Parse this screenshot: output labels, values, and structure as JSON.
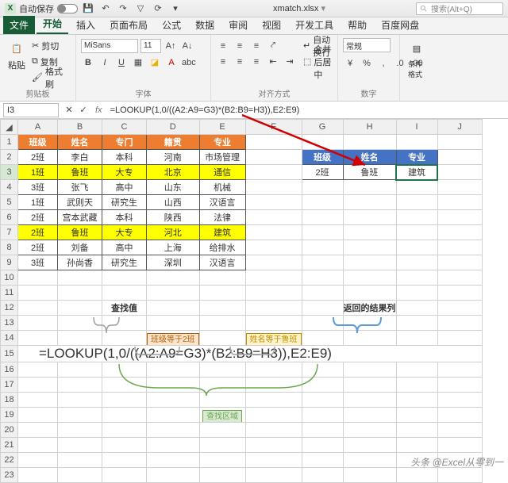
{
  "app": {
    "autosave": "自动保存",
    "filename": "xmatch.xlsx",
    "search_placeholder": "搜索(Alt+Q)"
  },
  "menu": {
    "file": "文件",
    "home": "开始",
    "insert": "插入",
    "layout": "页面布局",
    "formulas": "公式",
    "data": "数据",
    "review": "审阅",
    "view": "视图",
    "dev": "开发工具",
    "help": "帮助",
    "baidu": "百度网盘"
  },
  "ribbon": {
    "clipboard": {
      "paste": "粘贴",
      "cut": "剪切",
      "copy": "复制",
      "brush": "格式刷",
      "label": "剪贴板"
    },
    "font": {
      "name": "MiSans",
      "size": "11",
      "label": "字体"
    },
    "align": {
      "wrap": "自动换行",
      "merge": "合并后居中",
      "label": "对齐方式"
    },
    "number": {
      "general": "常规",
      "label": "数字"
    },
    "cond": {
      "label": "条件格式"
    }
  },
  "formula_bar": {
    "cell": "I3",
    "formula": "=LOOKUP(1,0/((A2:A9=G3)*(B2:B9=H3)),E2:E9)"
  },
  "cols": [
    "A",
    "B",
    "C",
    "D",
    "E",
    "F",
    "G",
    "H",
    "I",
    "J"
  ],
  "widths": [
    50,
    56,
    56,
    56,
    58,
    28,
    52,
    52,
    52,
    56
  ],
  "table": {
    "header": [
      "班级",
      "姓名",
      "专门",
      "籍贯",
      "专业"
    ],
    "rows": [
      [
        "2班",
        "李白",
        "本科",
        "河南",
        "市场管理"
      ],
      [
        "1班",
        "鲁班",
        "大专",
        "北京",
        "通信"
      ],
      [
        "3班",
        "张飞",
        "高中",
        "山东",
        "机械"
      ],
      [
        "1班",
        "武则天",
        "研究生",
        "山西",
        "汉语言"
      ],
      [
        "2班",
        "宫本武藏",
        "本科",
        "陕西",
        "法律"
      ],
      [
        "2班",
        "鲁班",
        "大专",
        "河北",
        "建筑"
      ],
      [
        "2班",
        "刘备",
        "高中",
        "上海",
        "给排水"
      ],
      [
        "3班",
        "孙尚香",
        "研究生",
        "深圳",
        "汉语言"
      ]
    ]
  },
  "lookup": {
    "header": [
      "班级",
      "姓名",
      "专业"
    ],
    "row": [
      "2班",
      "鲁班",
      "建筑"
    ]
  },
  "annotations": {
    "lookup_value": "查找值",
    "result_col": "返回的结果列",
    "class_eq": "班级等于2班",
    "name_eq": "姓名等于鲁班",
    "formula_big": "=LOOKUP(1,0/((A2:A9=G3)*(B2:B9=H3)),E2:E9)",
    "lookup_range": "查找区域"
  },
  "watermark": "头条 @Excel从零到一",
  "chart_data": {
    "type": "table",
    "title": "LOOKUP multi-condition example",
    "columns": [
      "班级",
      "姓名",
      "专门",
      "籍贯",
      "专业"
    ],
    "rows": [
      [
        "2班",
        "李白",
        "本科",
        "河南",
        "市场管理"
      ],
      [
        "1班",
        "鲁班",
        "大专",
        "北京",
        "通信"
      ],
      [
        "3班",
        "张飞",
        "高中",
        "山东",
        "机械"
      ],
      [
        "1班",
        "武则天",
        "研究生",
        "山西",
        "汉语言"
      ],
      [
        "2班",
        "宫本武藏",
        "本科",
        "陕西",
        "法律"
      ],
      [
        "2班",
        "鲁班",
        "大专",
        "河北",
        "建筑"
      ],
      [
        "2班",
        "刘备",
        "高中",
        "上海",
        "给排水"
      ],
      [
        "3班",
        "孙尚香",
        "研究生",
        "深圳",
        "汉语言"
      ]
    ],
    "lookup_input": {
      "班级": "2班",
      "姓名": "鲁班"
    },
    "lookup_output": {
      "专业": "建筑"
    },
    "formula": "=LOOKUP(1,0/((A2:A9=G3)*(B2:B9=H3)),E2:E9)"
  }
}
